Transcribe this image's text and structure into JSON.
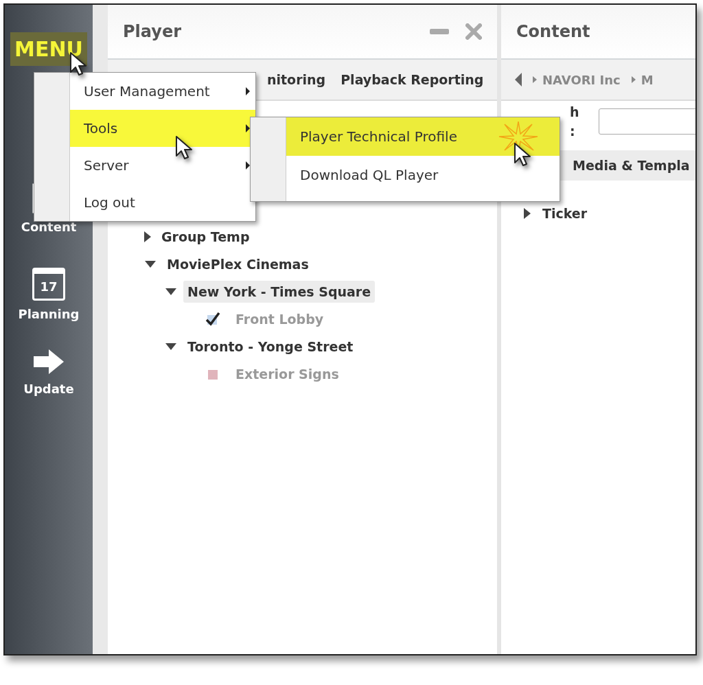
{
  "sidebar": {
    "menu_button": {
      "label": "MENU",
      "selected": true
    },
    "items": [
      {
        "label": "Content",
        "kind": "content"
      },
      {
        "label": "Planning",
        "kind": "calendar",
        "badge": "17"
      },
      {
        "label": "Update",
        "kind": "update"
      }
    ]
  },
  "player_panel": {
    "title": "Player",
    "tabs": [
      "nitoring",
      "Playback Reporting"
    ],
    "tree": [
      {
        "label": "Group Temp",
        "kind": "group",
        "expanded": false,
        "selected": false
      },
      {
        "label": "MoviePlex Cinemas",
        "kind": "group",
        "expanded": true,
        "selected": false,
        "children": [
          {
            "label": "New York - Times Square",
            "kind": "group",
            "expanded": true,
            "selected": true,
            "children": [
              {
                "label": "Front Lobby",
                "kind": "player",
                "checked": true,
                "selected": false
              }
            ]
          },
          {
            "label": "Toronto - Yonge Street",
            "kind": "group",
            "expanded": true,
            "selected": false,
            "children": [
              {
                "label": "Exterior Signs",
                "kind": "player",
                "checked": false,
                "selected": false
              }
            ]
          }
        ]
      }
    ]
  },
  "content_panel": {
    "title": "Content",
    "breadcrumb": [
      "NAVORI Inc",
      "M"
    ],
    "search_label": "h :",
    "section": "Media & Templa",
    "items": [
      {
        "label": "Ticker",
        "expanded": false
      }
    ]
  },
  "menu": {
    "items": [
      {
        "label": "User Management",
        "has_submenu": true,
        "selected": false
      },
      {
        "label": "Tools",
        "has_submenu": true,
        "selected": true
      },
      {
        "label": "Server",
        "has_submenu": true,
        "selected": false
      },
      {
        "label": "Log out",
        "has_submenu": false,
        "selected": false
      }
    ]
  },
  "submenu": {
    "items": [
      {
        "label": "Player Technical Profile",
        "selected": true
      },
      {
        "label": "Download QL Player",
        "selected": false
      }
    ]
  }
}
